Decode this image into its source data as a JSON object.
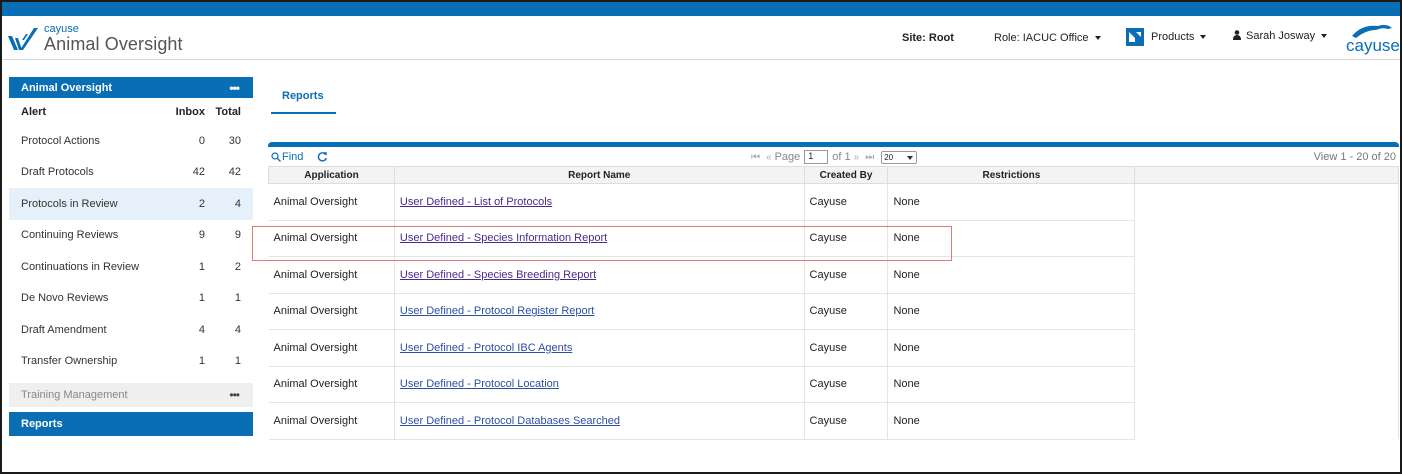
{
  "header": {
    "logo_small": "cayuse",
    "logo_big": "Animal Oversight",
    "site": "Site: Root",
    "role": "Role: IACUC Office",
    "products": "Products",
    "user": "Sarah Josway",
    "brand": "cayuse"
  },
  "sidebar": {
    "title": "Animal Oversight",
    "col_alert": "Alert",
    "col_inbox": "Inbox",
    "col_total": "Total",
    "items": [
      {
        "label": "Protocol Actions",
        "inbox": "0",
        "total": "30"
      },
      {
        "label": "Draft Protocols",
        "inbox": "42",
        "total": "42"
      },
      {
        "label": "Protocols in Review",
        "inbox": "2",
        "total": "4"
      },
      {
        "label": "Continuing Reviews",
        "inbox": "9",
        "total": "9"
      },
      {
        "label": "Continuations in Review",
        "inbox": "1",
        "total": "2"
      },
      {
        "label": "De Novo Reviews",
        "inbox": "1",
        "total": "1"
      },
      {
        "label": "Draft Amendment",
        "inbox": "4",
        "total": "4"
      },
      {
        "label": "Transfer Ownership",
        "inbox": "1",
        "total": "1"
      }
    ],
    "training": "Training Management",
    "reports": "Reports"
  },
  "tab": {
    "label": "Reports"
  },
  "grid": {
    "find": "Find",
    "page_label": "Page",
    "page_value": "1",
    "of_label": "of 1",
    "page_size": "20",
    "view_info": "View 1 - 20 of 20",
    "columns": [
      "Application",
      "Report Name",
      "Created By",
      "Restrictions"
    ],
    "rows": [
      {
        "application": "Animal Oversight",
        "report": "User Defined - List of Protocols",
        "created_by": "Cayuse",
        "restrictions": "None"
      },
      {
        "application": "Animal Oversight",
        "report": "User Defined - Species Information Report",
        "created_by": "Cayuse",
        "restrictions": "None"
      },
      {
        "application": "Animal Oversight",
        "report": "User Defined - Species Breeding Report",
        "created_by": "Cayuse",
        "restrictions": "None"
      },
      {
        "application": "Animal Oversight",
        "report": "User Defined - Protocol Register Report",
        "created_by": "Cayuse",
        "restrictions": "None"
      },
      {
        "application": "Animal Oversight",
        "report": "User Defined - Protocol IBC Agents",
        "created_by": "Cayuse",
        "restrictions": "None"
      },
      {
        "application": "Animal Oversight",
        "report": "User Defined - Protocol Location",
        "created_by": "Cayuse",
        "restrictions": "None"
      },
      {
        "application": "Animal Oversight",
        "report": "User Defined - Protocol Databases Searched",
        "created_by": "Cayuse",
        "restrictions": "None"
      }
    ]
  },
  "colors": {
    "brand_blue": "#0a6eb4",
    "highlight": "#e07a7a",
    "visited_link": "#4b2a8a",
    "link": "#2d4fa0"
  }
}
